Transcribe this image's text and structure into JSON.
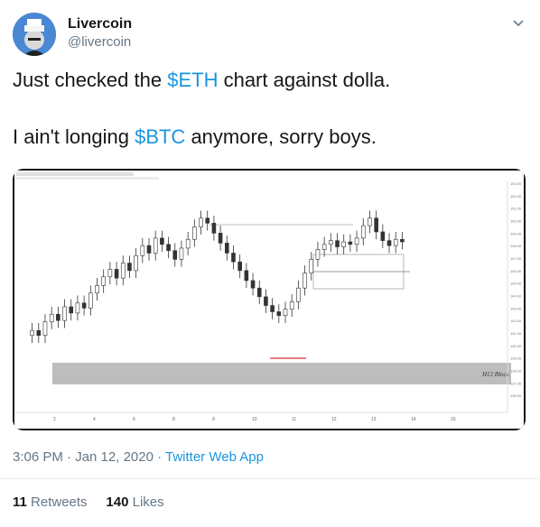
{
  "author": {
    "name": "Livercoin",
    "handle": "@livercoin"
  },
  "tweet": {
    "line1_before": "Just checked the ",
    "line1_cashtag": "$ETH",
    "line1_after": " chart against dolla.",
    "line2_before": "I ain't longing ",
    "line2_cashtag": "$BTC",
    "line2_after": " anymore, sorry boys."
  },
  "media": {
    "zone_label": "H12 Block",
    "chart_data": {
      "type": "candlestick",
      "title": "",
      "xlabel": "",
      "ylabel": "",
      "x_tick_labels": [
        "2",
        "4",
        "6",
        "8",
        "9",
        "10",
        "11",
        "12",
        "13",
        "14",
        "15"
      ],
      "ylim": [
        135,
        153
      ],
      "series": [
        {
          "values": [
            141.2,
            140.8,
            141.9,
            142.5,
            142.0,
            143.1,
            142.6,
            143.4,
            143.0,
            144.2,
            144.8,
            145.5,
            146.1,
            145.4,
            146.6,
            146.0,
            147.2,
            148.0,
            147.4,
            148.6,
            148.1,
            147.6,
            146.9,
            147.8,
            148.5,
            149.5,
            150.2,
            149.8,
            149.0,
            148.2,
            147.4,
            146.7,
            146.0,
            145.2,
            144.6,
            143.9,
            143.2,
            142.7,
            142.4,
            142.9,
            143.5,
            144.6,
            145.8,
            146.9,
            147.7,
            148.1,
            148.4,
            147.9,
            148.3,
            148.1,
            148.6,
            149.6,
            150.2,
            149.1,
            148.4,
            148.0,
            148.5,
            148.3
          ]
        }
      ]
    }
  },
  "meta": {
    "time": "3:06 PM · Jan 12, 2020 · ",
    "app": "Twitter Web App"
  },
  "stats": {
    "retweets_count": "11",
    "retweets_label": " Retweets",
    "likes_count": "140",
    "likes_label": " Likes"
  },
  "colors": {
    "cashtag": "#1b95e0",
    "chart_bg": "#ffffff",
    "zone": "#bdbdbd"
  },
  "icons": {
    "chevron": "chevron-down-icon"
  }
}
